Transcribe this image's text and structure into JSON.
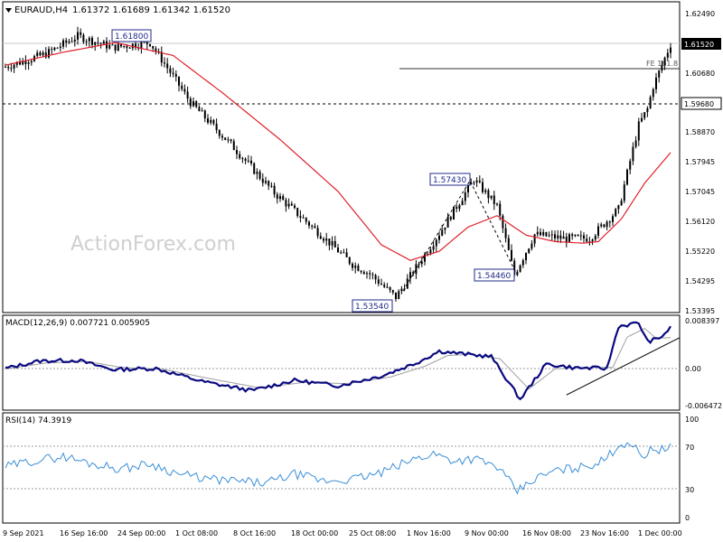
{
  "header": {
    "symbol": "EURAUD,H4",
    "ohlc": "1.61372 1.61689 1.61342 1.61520"
  },
  "watermark": "ActionForex.com",
  "colors": {
    "background": "#ffffff",
    "candle": "#000000",
    "ma": "#e0202a",
    "macd_line": "#0a0a80",
    "macd_signal": "#a0a0a0",
    "rsi": "#3a8ed8",
    "annotation_box_border": "#1f2a8a",
    "annotation_box_fill": "#ffffff",
    "grid_dash": "#9a9a9a"
  },
  "chart_data": [
    {
      "type": "candlestick",
      "title": "EURAUD,H4",
      "ylim": [
        1.5339,
        1.6249
      ],
      "y_ticks": [
        "1.62490",
        "1.60680",
        "1.58870",
        "1.57945",
        "1.57045",
        "1.56120",
        "1.55220",
        "1.54295",
        "1.53395"
      ],
      "x_labels": [
        "9 Sep 2021",
        "16 Sep 16:00",
        "24 Sep 00:00",
        "1 Oct 08:00",
        "8 Oct 16:00",
        "18 Oct 00:00",
        "25 Oct 08:00",
        "1 Nov 16:00",
        "9 Nov 00:00",
        "16 Nov 08:00",
        "23 Nov 16:00",
        "1 Dec 00:00"
      ],
      "price_path": {
        "index": [
          0,
          14,
          25,
          37,
          50,
          55,
          64,
          78,
          93,
          108,
          120,
          126,
          135,
          150,
          162,
          170,
          176,
          183,
          193,
          202,
          212,
          219,
          222,
          224,
          230
        ],
        "value": [
          1.609,
          1.613,
          1.6185,
          1.615,
          1.6165,
          1.61,
          1.598,
          1.585,
          1.57,
          1.558,
          1.548,
          1.545,
          1.5378,
          1.5575,
          1.5742,
          1.566,
          1.5448,
          1.5572,
          1.556,
          1.556,
          1.565,
          1.591,
          1.596,
          1.603,
          1.616
        ]
      },
      "moving_average": {
        "index": [
          0,
          20,
          38,
          58,
          75,
          95,
          115,
          130,
          140,
          150,
          160,
          170,
          180,
          190,
          200,
          205,
          213,
          221,
          230
        ],
        "value": [
          1.6095,
          1.6135,
          1.6165,
          1.6125,
          1.601,
          1.5865,
          1.5705,
          1.554,
          1.5492,
          1.552,
          1.5595,
          1.563,
          1.557,
          1.555,
          1.5545,
          1.555,
          1.562,
          1.573,
          1.5825
        ]
      },
      "annotations": [
        {
          "label": "1.61800",
          "value": 1.618
        },
        {
          "label": "1.57430",
          "value": 1.5743
        },
        {
          "label": "1.54460",
          "value": 1.5446
        },
        {
          "label": "1.53540",
          "value": 1.5354
        }
      ],
      "levels": [
        {
          "label": "1.59680",
          "value": 1.5968,
          "style": "dashed"
        },
        {
          "label": "FE 161.8",
          "value": 1.608,
          "style": "solid"
        },
        {
          "label": "1.61520",
          "value": 1.6152,
          "style": "current"
        }
      ]
    },
    {
      "type": "line",
      "title": "MACD(12,26,9) 0.007721 0.005905",
      "ylim": [
        -0.00717,
        0.00937
      ],
      "y_ticks": [
        "0.008397",
        "0.00",
        "-0.006472"
      ],
      "series": [
        {
          "name": "MACD",
          "index": [
            0,
            12,
            25,
            37,
            52,
            68,
            85,
            100,
            115,
            130,
            142,
            150,
            158,
            168,
            178,
            187,
            197,
            208,
            212,
            219,
            222,
            226,
            230
          ],
          "value": [
            0.0002,
            0.0016,
            0.0017,
            0.0,
            0.0002,
            -0.0022,
            -0.0039,
            -0.002,
            -0.003,
            -0.0012,
            0.0012,
            0.0034,
            0.0029,
            0.0024,
            -0.0055,
            0.001,
            0.0003,
            0.0002,
            0.008,
            0.0086,
            0.0052,
            0.0057,
            0.0077
          ]
        },
        {
          "name": "Signal",
          "index": [
            0,
            14,
            28,
            40,
            55,
            70,
            88,
            103,
            118,
            133,
            145,
            153,
            161,
            171,
            181,
            190,
            200,
            210,
            215,
            221,
            225,
            230
          ],
          "value": [
            0.0001,
            0.0012,
            0.0015,
            0.0004,
            0.0,
            -0.0016,
            -0.0034,
            -0.0024,
            -0.0026,
            -0.0014,
            0.0006,
            0.0026,
            0.0028,
            0.002,
            -0.0036,
            0.0001,
            0.0004,
            0.0004,
            0.006,
            0.0076,
            0.0058,
            0.0059
          ]
        }
      ],
      "trendline_value": [
        -0.0047,
        0.0059
      ]
    },
    {
      "type": "line",
      "title": "RSI(14) 74.3919",
      "ylim": [
        0,
        100
      ],
      "y_ticks": [
        "100",
        "70",
        "30",
        "0"
      ],
      "levels": [
        70,
        30
      ],
      "series": [
        {
          "name": "RSI",
          "index": [
            0,
            10,
            20,
            30,
            40,
            50,
            60,
            70,
            80,
            90,
            100,
            110,
            120,
            130,
            140,
            148,
            155,
            162,
            170,
            177,
            183,
            190,
            200,
            207,
            212,
            216,
            220,
            224,
            228,
            230
          ],
          "value": [
            52,
            58,
            62,
            55,
            50,
            55,
            45,
            40,
            38,
            36,
            45,
            38,
            40,
            46,
            58,
            65,
            58,
            60,
            52,
            28,
            40,
            48,
            52,
            58,
            73,
            76,
            62,
            70,
            68,
            74
          ]
        }
      ]
    }
  ]
}
